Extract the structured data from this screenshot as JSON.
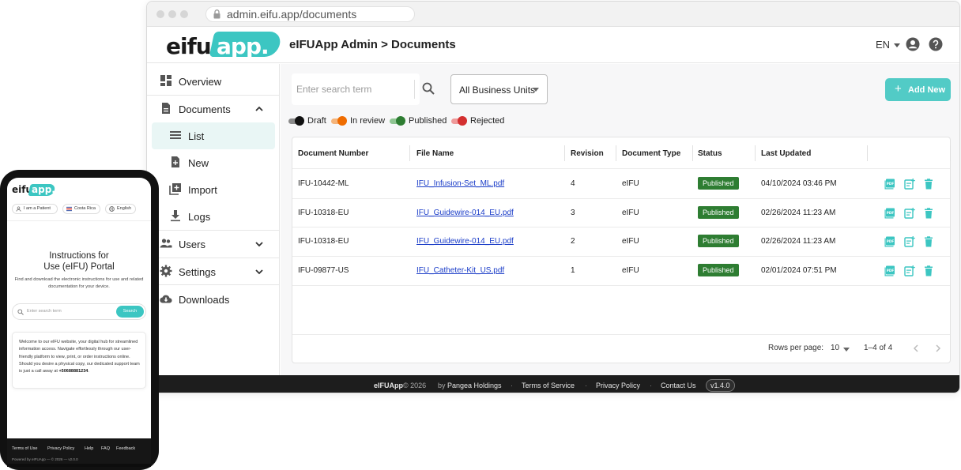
{
  "browser": {
    "url": "admin.eifu.app/documents"
  },
  "header": {
    "logo_left": "eifu",
    "logo_right": "app.",
    "title": "eIFUApp Admin > Documents",
    "language": "EN"
  },
  "sidebar": {
    "items": [
      {
        "label": "Overview",
        "icon": "dashboard-icon"
      },
      {
        "label": "Documents",
        "icon": "document-icon"
      },
      {
        "label": "List",
        "icon": "list-icon"
      },
      {
        "label": "New",
        "icon": "new-document-icon"
      },
      {
        "label": "Import",
        "icon": "import-icon"
      },
      {
        "label": "Logs",
        "icon": "download-log-icon"
      },
      {
        "label": "Users",
        "icon": "users-icon"
      },
      {
        "label": "Settings",
        "icon": "gear-icon"
      },
      {
        "label": "Downloads",
        "icon": "cloud-download-icon"
      }
    ]
  },
  "toolbar": {
    "search_placeholder": "Enter search term",
    "business_unit": "All Business Units",
    "add_label": "Add New"
  },
  "legend": [
    {
      "label": "Draft",
      "color": "#111111",
      "track": "#8a8a8a"
    },
    {
      "label": "In review",
      "color": "#ef6c00",
      "track": "#f5b47a"
    },
    {
      "label": "Published",
      "color": "#2e7d32",
      "track": "#8fc592"
    },
    {
      "label": "Rejected",
      "color": "#d32f2f",
      "track": "#ef9a9a"
    }
  ],
  "table": {
    "columns": [
      "Document Number",
      "File Name",
      "Revision",
      "Document Type",
      "Status",
      "Last Updated"
    ],
    "rows": [
      {
        "number": "IFU-10442-ML",
        "file": "IFU_Infusion-Set_ML.pdf",
        "revision": "4",
        "type": "eIFU",
        "status": "Published",
        "updated": "04/10/2024 03:46 PM"
      },
      {
        "number": "IFU-10318-EU",
        "file": "IFU_Guidewire-014_EU.pdf",
        "revision": "3",
        "type": "eIFU",
        "status": "Published",
        "updated": "02/26/2024 11:23 AM"
      },
      {
        "number": "IFU-10318-EU",
        "file": "IFU_Guidewire-014_EU.pdf",
        "revision": "2",
        "type": "eIFU",
        "status": "Published",
        "updated": "02/26/2024 11:23 AM"
      },
      {
        "number": "IFU-09877-US",
        "file": "IFU_Catheter-Kit_US.pdf",
        "revision": "1",
        "type": "eIFU",
        "status": "Published",
        "updated": "02/01/2024 07:51 PM"
      }
    ],
    "rows_per_page_label": "Rows per page:",
    "rows_per_page": "10",
    "range": "1–4 of 4"
  },
  "footer": {
    "brand": "eIFUApp",
    "copyright": "© 2026",
    "by": "by",
    "company": "Pangea Holdings",
    "dot": "·",
    "terms": "Terms of Service",
    "privacy": "Privacy Policy",
    "contact": "Contact Us",
    "version": "v1.4.0"
  },
  "phone": {
    "logo_left": "eifu",
    "logo_right": "app.",
    "chips": [
      "I am a Patient",
      "Costa Rica",
      "English"
    ],
    "title_line1": "Instructions for",
    "title_line2": "Use (eIFU) Portal",
    "subtitle": "Find and download the electronic instructions for use and related documentation for your device.",
    "search_placeholder": "Enter search term",
    "search_button": "Search",
    "welcome": "Welcome to our eIFU website, your digital hub for streamlined information access. Navigate effortlessly through our user-friendly platform to view, print, or order instructions online. Should you desire a physical copy, our dedicated support team is just a call away at",
    "phone_number": "+50688881234",
    "period": ".",
    "footer_links": [
      "Terms of Use",
      "Privacy Policy",
      "Help",
      "FAQ",
      "Feedback"
    ],
    "powered": "Powered by eIFUApp — © 2026 — v2.0.0"
  },
  "colors": {
    "accent": "#3cc6c2",
    "published": "#2e7d32",
    "link": "#1a3cc8"
  }
}
